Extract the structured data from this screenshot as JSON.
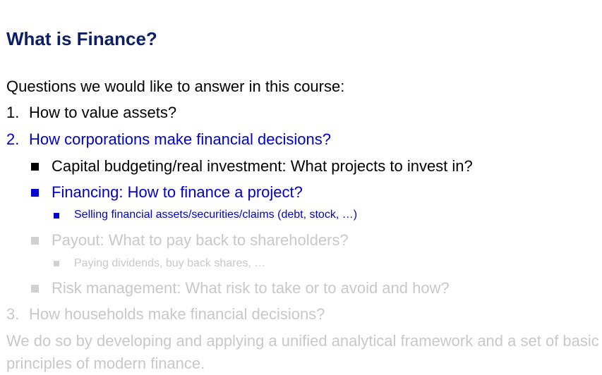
{
  "slide": {
    "title": "What is Finance?",
    "intro": "Questions we would like to answer in this course:",
    "items": [
      {
        "number": "1.",
        "text": "How to value assets?"
      },
      {
        "number": "2.",
        "text": "How corporations make financial decisions?"
      },
      {
        "number": "3.",
        "text": "How households make financial decisions?"
      }
    ],
    "subitems": [
      {
        "text": "Capital budgeting/real investment: What projects to invest in?"
      },
      {
        "text": "Financing: How to finance a project?"
      },
      {
        "text": "Payout: What to pay back to shareholders?"
      },
      {
        "text": "Risk management: What risk to take or to avoid and how?"
      }
    ],
    "subsubitems": [
      {
        "text": "Selling financial assets/securities/claims (debt, stock, …)"
      },
      {
        "text": "Paying dividends, buy back shares, …"
      }
    ],
    "conclusion": "We do so by developing and applying a unified analytical framework and a set of basic principles of modern finance."
  },
  "colors": {
    "title": "#0c1f66",
    "active": "#0000d0",
    "normal": "#000000",
    "dimmed": "#c8c8c8"
  }
}
